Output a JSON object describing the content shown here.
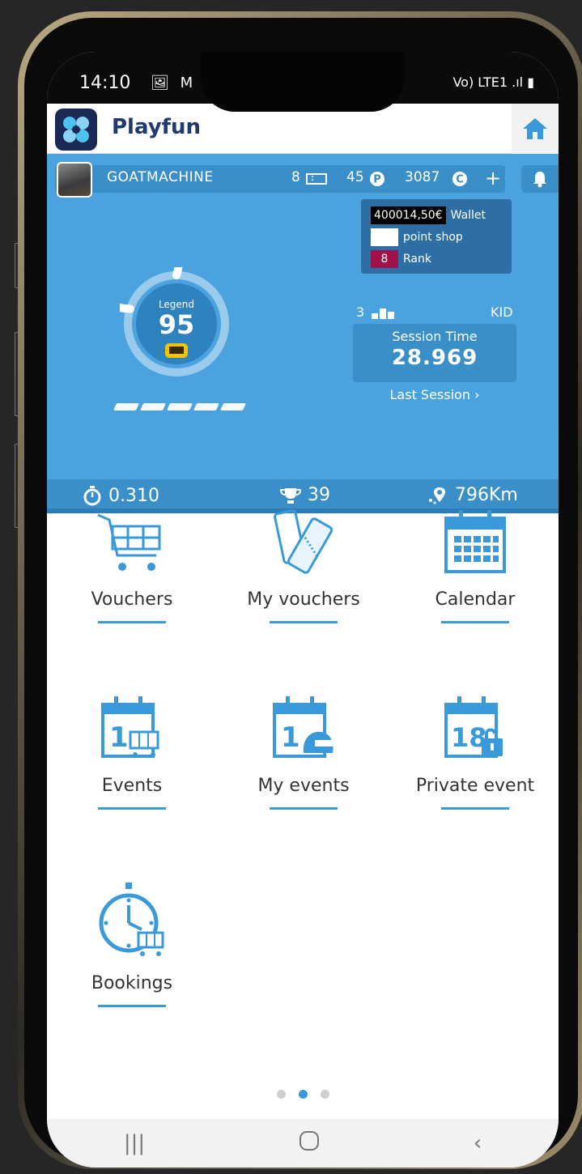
{
  "status_bar": {
    "time": "14:10",
    "left_icons": "🖼 M ▶",
    "right_icons": "Vo) LTE1 .ıl ▮"
  },
  "app": {
    "title": "Playfun"
  },
  "user": {
    "name": "GOATMACHINE",
    "tickets": "8",
    "points": "45",
    "credits": "3087"
  },
  "dropdown": {
    "wallet_value": "400014,50€",
    "wallet_label": "Wallet",
    "point_shop_label": "point shop",
    "rank_value": "8",
    "rank_label": "Rank"
  },
  "gauge": {
    "label": "Legend",
    "value": "95",
    "level_fraction": 0.8
  },
  "podium": {
    "value": "3"
  },
  "category": "KID",
  "session": {
    "label": "Session Time",
    "value": "28.969",
    "last_session": "Last Session"
  },
  "stats": {
    "best_lap": "0.310",
    "trophies": "39",
    "distance": "796Km"
  },
  "tiles": {
    "vouchers": "Vouchers",
    "my_vouchers": "My vouchers",
    "calendar": "Calendar",
    "events": "Events",
    "my_events": "My events",
    "private_event": "Private event",
    "bookings": "Bookings"
  },
  "pager": {
    "active_index": 1,
    "total": 3
  },
  "colors": {
    "primary": "#4aa3de",
    "dark": "#3a8fc9",
    "accent": "#3a9ad9",
    "rank_badge": "#a0104a"
  },
  "icons": [
    "home-icon",
    "bell-icon",
    "ticket-icon",
    "points-icon",
    "credits-icon",
    "stopwatch-icon",
    "trophy-icon",
    "location-icon",
    "cart-icon",
    "tickets-icon",
    "calendar-icon",
    "events-cart-icon",
    "events-helmet-icon",
    "events-lock-icon",
    "bookings-clock-icon"
  ]
}
